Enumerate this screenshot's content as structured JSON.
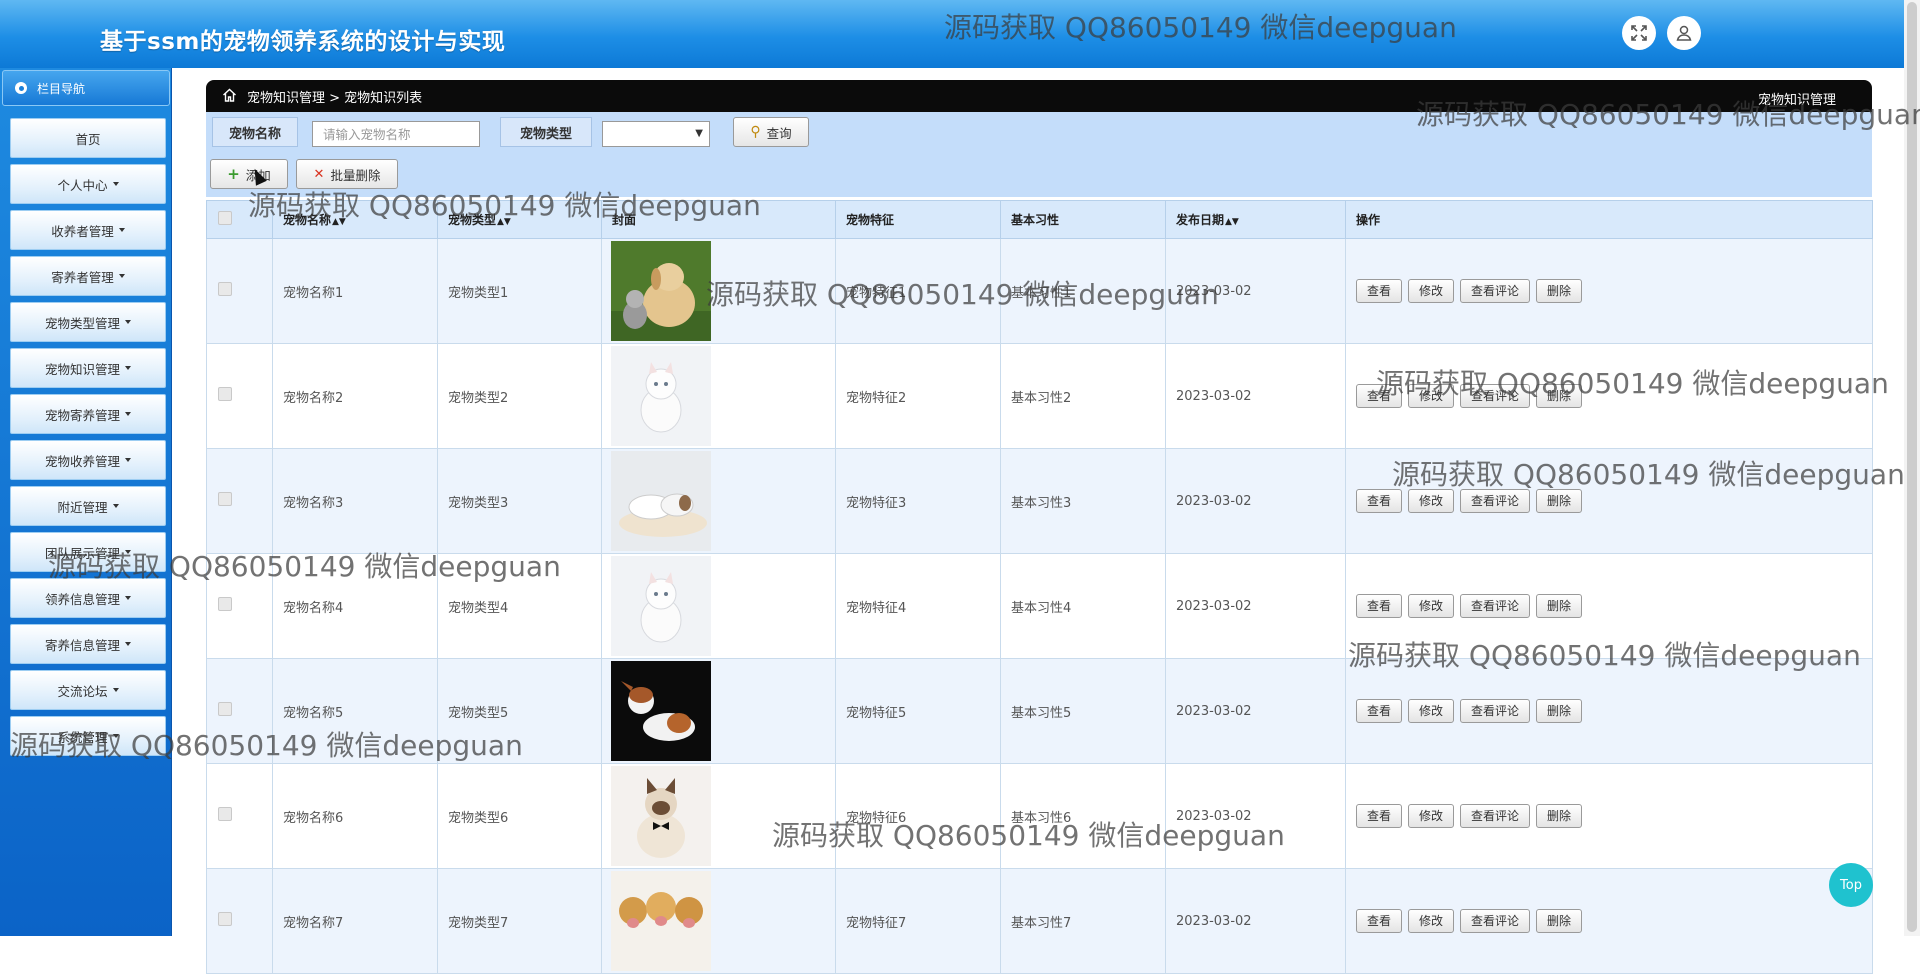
{
  "header": {
    "app_title": "基于ssm的宠物领养系统的设计与实现",
    "fullscreen_icon": "expand-icon",
    "user_icon": "user-icon"
  },
  "sidebar": {
    "title": "栏目导航",
    "items": [
      {
        "label": "首页",
        "has_dropdown": false
      },
      {
        "label": "个人中心",
        "has_dropdown": true
      },
      {
        "label": "收养者管理",
        "has_dropdown": true
      },
      {
        "label": "寄养者管理",
        "has_dropdown": true
      },
      {
        "label": "宠物类型管理",
        "has_dropdown": true
      },
      {
        "label": "宠物知识管理",
        "has_dropdown": true
      },
      {
        "label": "宠物寄养管理",
        "has_dropdown": true
      },
      {
        "label": "宠物收养管理",
        "has_dropdown": true
      },
      {
        "label": "附近管理",
        "has_dropdown": true
      },
      {
        "label": "团队展示管理",
        "has_dropdown": true
      },
      {
        "label": "领养信息管理",
        "has_dropdown": true
      },
      {
        "label": "寄养信息管理",
        "has_dropdown": true
      },
      {
        "label": "交流论坛",
        "has_dropdown": true
      },
      {
        "label": "系统管理",
        "has_dropdown": true
      }
    ]
  },
  "breadcrumb": {
    "path": "宠物知识管理 > 宠物知识列表",
    "right_title": "宠物知识管理"
  },
  "search": {
    "name_label": "宠物名称",
    "name_placeholder": "请输入宠物名称",
    "type_label": "宠物类型",
    "type_value": "",
    "search_button": "查询",
    "add_button": "添加",
    "batch_delete_button": "批量删除"
  },
  "table": {
    "columns": [
      "宠物名称",
      "宠物类型",
      "封面",
      "宠物特征",
      "基本习性",
      "发布日期",
      "操作"
    ],
    "actions": [
      "查看",
      "修改",
      "查看评论",
      "删除"
    ],
    "rows": [
      {
        "name": "宠物名称1",
        "type": "宠物类型1",
        "cover": "puppy-kitten-photo",
        "feature": "宠物特征1",
        "habit": "基本习性1",
        "date": "2023-03-02"
      },
      {
        "name": "宠物名称2",
        "type": "宠物类型2",
        "cover": "white-kitten-photo",
        "feature": "宠物特征2",
        "habit": "基本习性2",
        "date": "2023-03-02"
      },
      {
        "name": "宠物名称3",
        "type": "宠物类型3",
        "cover": "sleeping-cat-dog-photo",
        "feature": "宠物特征3",
        "habit": "基本习性3",
        "date": "2023-03-02"
      },
      {
        "name": "宠物名称4",
        "type": "宠物类型4",
        "cover": "white-kitten-photo",
        "feature": "宠物特征4",
        "habit": "基本习性4",
        "date": "2023-03-02"
      },
      {
        "name": "宠物名称5",
        "type": "宠物类型5",
        "cover": "dog-black-background-photo",
        "feature": "宠物特征5",
        "habit": "基本习性5",
        "date": "2023-03-02"
      },
      {
        "name": "宠物名称6",
        "type": "宠物类型6",
        "cover": "cat-bowtie-photo",
        "feature": "宠物特征6",
        "habit": "基本习性6",
        "date": "2023-03-02"
      },
      {
        "name": "宠物名称7",
        "type": "宠物类型7",
        "cover": "golden-puppies-photo",
        "feature": "宠物特征7",
        "habit": "基本习性7",
        "date": "2023-03-02"
      }
    ]
  },
  "watermark": "源码获取 QQ86050149 微信deepguan",
  "back_to_top": "Top",
  "colors": {
    "header_blue": "#1d8ee6",
    "sidebar_blue": "#0b63c7",
    "search_bg": "#c4ddfa",
    "row_alt": "#edf4fd",
    "top_button": "#1fc2cf"
  }
}
